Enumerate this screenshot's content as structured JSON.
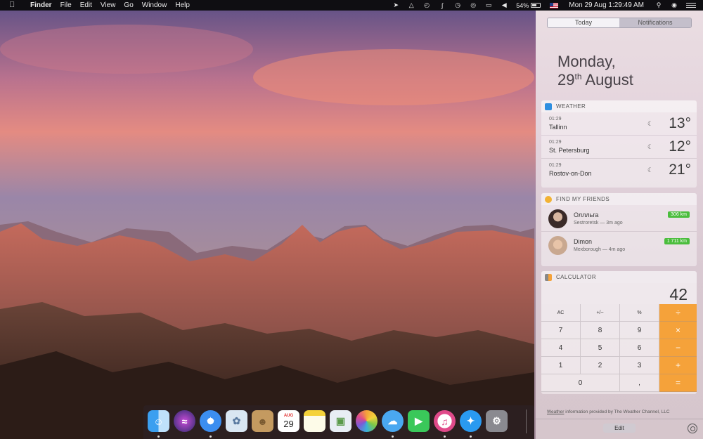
{
  "menubar": {
    "app_name": "Finder",
    "menus": [
      "File",
      "Edit",
      "View",
      "Go",
      "Window",
      "Help"
    ],
    "battery": "54%",
    "clock": "Mon 29 Aug  1:29:49 AM"
  },
  "notification_center": {
    "tabs": [
      "Today",
      "Notifications"
    ],
    "active_tab": "Today",
    "date_line1": "Monday,",
    "date_day": "29",
    "date_suffix": "th",
    "date_month": "August",
    "weather": {
      "title": "WEATHER",
      "rows": [
        {
          "time": "01:29",
          "city": "Tallinn",
          "temp": "13°"
        },
        {
          "time": "01:29",
          "city": "St. Petersburg",
          "temp": "12°"
        },
        {
          "time": "01:29",
          "city": "Rostov-on-Don",
          "temp": "21°"
        }
      ]
    },
    "friends": {
      "title": "FIND MY FRIENDS",
      "rows": [
        {
          "name": "Оллльга",
          "place": "Sestroretsk  —  3m ago",
          "distance": "306 km"
        },
        {
          "name": "Dimon",
          "place": "Mexborough  —  4m ago",
          "distance": "1 711 km"
        }
      ]
    },
    "calculator": {
      "title": "CALCULATOR",
      "display": "42",
      "keys": {
        "ac": "AC",
        "sign": "+/−",
        "pct": "%",
        "div": "÷",
        "k7": "7",
        "k8": "8",
        "k9": "9",
        "mul": "×",
        "k4": "4",
        "k5": "5",
        "k6": "6",
        "sub": "−",
        "k1": "1",
        "k2": "2",
        "k3": "3",
        "add": "+",
        "k0": "0",
        "dot": ",",
        "eq": "="
      }
    },
    "credit_link": "Weather",
    "credit_text": " information provided by The Weather Channel, LLC",
    "edit_label": "Edit"
  },
  "dock": {
    "calendar_month": "AUG",
    "calendar_day": "29"
  },
  "colors": {
    "accent_orange": "#f5a23a",
    "distance_green": "#4bbd3d"
  }
}
